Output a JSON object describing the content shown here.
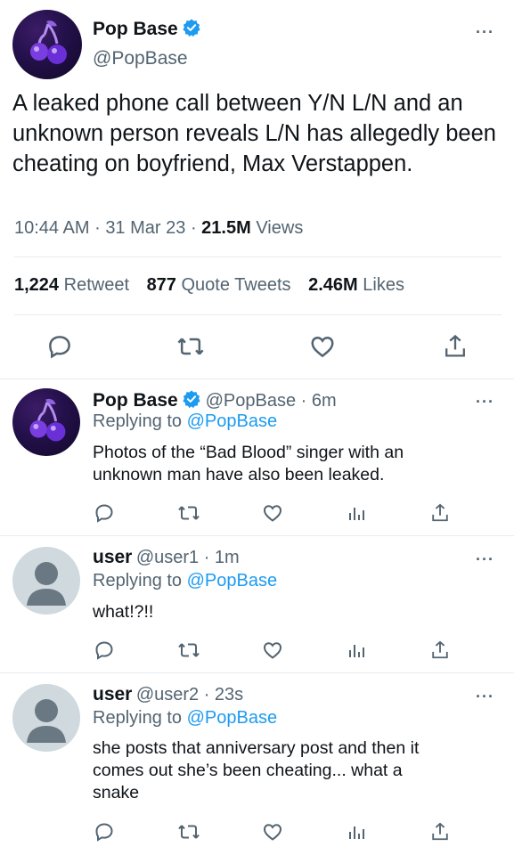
{
  "main_tweet": {
    "author_name": "Pop Base",
    "author_handle": "@PopBase",
    "text": "A leaked phone call between Y/N L/N and an unknown person reveals L/N has allegedly been cheating on boyfriend, Max Verstappen.",
    "time": "10:44 AM",
    "sep": "·",
    "date": "31 Mar 23",
    "views_count": "21.5M",
    "views_label": "Views",
    "retweets_count": "1,224",
    "retweets_label": "Retweet",
    "quotes_count": "877",
    "quotes_label": "Quote Tweets",
    "likes_count": "2.46M",
    "likes_label": "Likes",
    "more": "···"
  },
  "replies": [
    {
      "name": "Pop Base",
      "handle": "@PopBase · 6m",
      "replying_prefix": "Replying to",
      "replying_to": "@PopBase",
      "text_lines": [
        "Photos of the “Bad Blood” singer with an",
        "unknown man have also been leaked."
      ],
      "more": "···"
    },
    {
      "name": "user",
      "handle": "@user1 · 1m",
      "replying_prefix": "Replying to",
      "replying_to": "@PopBase",
      "text_lines": [
        "what!?!!"
      ],
      "more": "···"
    },
    {
      "name": "user",
      "handle": "@user2 · 23s",
      "replying_prefix": "Replying to",
      "replying_to": "@PopBase",
      "text_lines": [
        "she posts that anniversary post and then it",
        "comes out she’s been cheating... what a",
        "snake"
      ],
      "more": "···"
    }
  ],
  "colors": {
    "accent": "#1d9bf0",
    "secondary_text": "#536471",
    "divider": "#e6ecf0"
  },
  "icons": [
    "cherry-logo-icon",
    "verified-badge-icon",
    "reply-icon",
    "retweet-icon",
    "like-icon",
    "analytics-icon",
    "share-icon",
    "more-icon",
    "default-avatar-icon"
  ]
}
